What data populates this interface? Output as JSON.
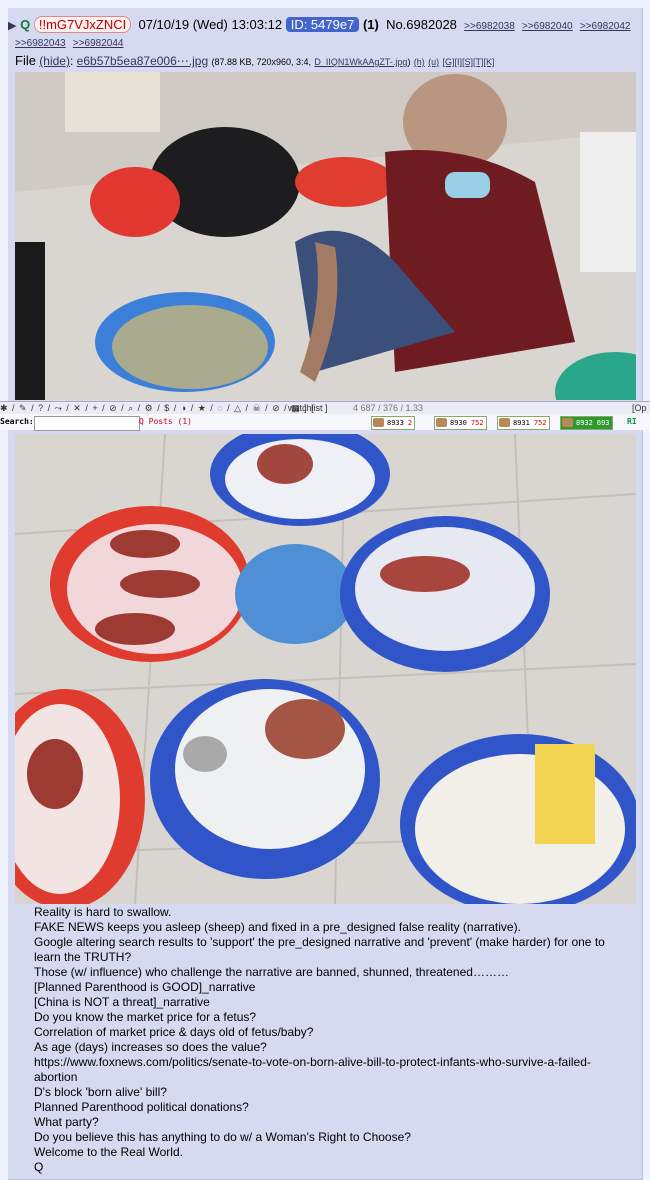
{
  "post": {
    "name": "Q",
    "tripcode": "!!mG7VJxZNCI",
    "date": "07/10/19 (Wed) 13:03:12",
    "id_label": "ID: 5479e7",
    "count": "(1)",
    "number": "No.6982028",
    "backlinks": [
      ">>6982038",
      ">>6982040",
      ">>6982042",
      ">>6982043",
      ">>6982044"
    ]
  },
  "file": {
    "label": "File",
    "hide": "(hide)",
    "sep": ":",
    "filename": "e6b57b5ea87e006⋯.jpg",
    "meta": "(87.88 KB, 720x960, 3:4,",
    "orig_name": "D_IIQN1WkAAgZT-.jpg",
    "meta_end": ")",
    "links": [
      "(h)",
      "(u)",
      "[G]",
      "[I]",
      "[S]",
      "[T]",
      "[K]"
    ]
  },
  "toolbar": {
    "icons": "✱ / ✎ / ? / ⤳ / ✕ / + / ⊘ / ⌕ / ⚙ / $ / ◑ / ★ / ◌ / △ / ☠ / ⊘ / ▦ ] [",
    "watchlist": "watchlist ]",
    "stats": "4  687 / 376 / 1.33",
    "open": "[Op"
  },
  "searchbar": {
    "label": "Search:",
    "input_value": "",
    "q_posts": "Q Posts (1)",
    "widgets": [
      {
        "v1": "8933",
        "v2": "2"
      },
      {
        "v1": "8930",
        "v2": "752"
      },
      {
        "v1": "8931",
        "v2": "752"
      },
      {
        "v1": "8932",
        "v2": "693"
      }
    ],
    "ri": "RI"
  },
  "message": [
    "Reality is hard to swallow.",
    "FAKE NEWS keeps you asleep (sheep) and fixed in a pre_designed false reality (narrative).",
    "Google altering search results to 'support' the pre_designed narrative and 'prevent' (make harder) for one to learn the TRUTH?",
    "Those (w/ influence) who challenge the narrative are banned, shunned, threatened………",
    "[Planned Parenthood is GOOD]_narrative",
    "[China is NOT a threat]_narrative",
    "Do you know the market price for a fetus?",
    "Correlation of market price & days old of fetus/baby?",
    "As age (days) increases so does the value?",
    "https://www.foxnews.com/politics/senate-to-vote-on-born-alive-bill-to-protect-infants-who-survive-a-failed-abortion",
    "D's block 'born alive' bill?",
    "Planned Parenthood political donations?",
    "What party?",
    "Do you believe this has anything to do w/ a Woman's Right to Choose?",
    "Welcome to the Real World.",
    "Q"
  ]
}
